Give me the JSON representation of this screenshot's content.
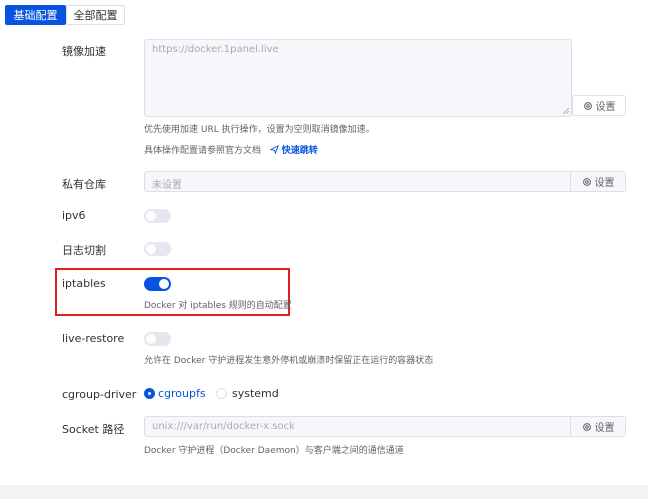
{
  "tabs": {
    "basic": "基础配置",
    "all": "全部配置"
  },
  "mirror": {
    "label": "镜像加速",
    "placeholder": "https://docker.1panel.live",
    "set_button": "设置",
    "help": "优先使用加速 URL 执行操作，设置为空则取消镜像加速。",
    "doc_text": "具体操作配置请参照官方文档",
    "doc_link": "快速跳转"
  },
  "registry": {
    "label": "私有仓库",
    "value": "未设置",
    "set_button": "设置"
  },
  "ipv6": {
    "label": "ipv6",
    "enabled": false
  },
  "log_rotate": {
    "label": "日志切割",
    "enabled": false
  },
  "iptables": {
    "label": "iptables",
    "enabled": true,
    "help": "Docker 对 iptables 规则的自动配置"
  },
  "live_restore": {
    "label": "live-restore",
    "enabled": false,
    "help": "允许在 Docker 守护进程发生意外停机或崩溃时保留正在运行的容器状态"
  },
  "cgroup": {
    "label": "cgroup-driver",
    "options": [
      "cgroupfs",
      "systemd"
    ],
    "selected": "cgroupfs"
  },
  "socket": {
    "label": "Socket 路径",
    "value": "unix:///var/run/docker-x.sock",
    "set_button": "设置",
    "help": "Docker 守护进程（Docker Daemon）与客户端之间的通信通道"
  },
  "colors": {
    "primary": "#0854e0",
    "highlight_border": "#e02020",
    "switch_off": "#e4e7ed"
  }
}
